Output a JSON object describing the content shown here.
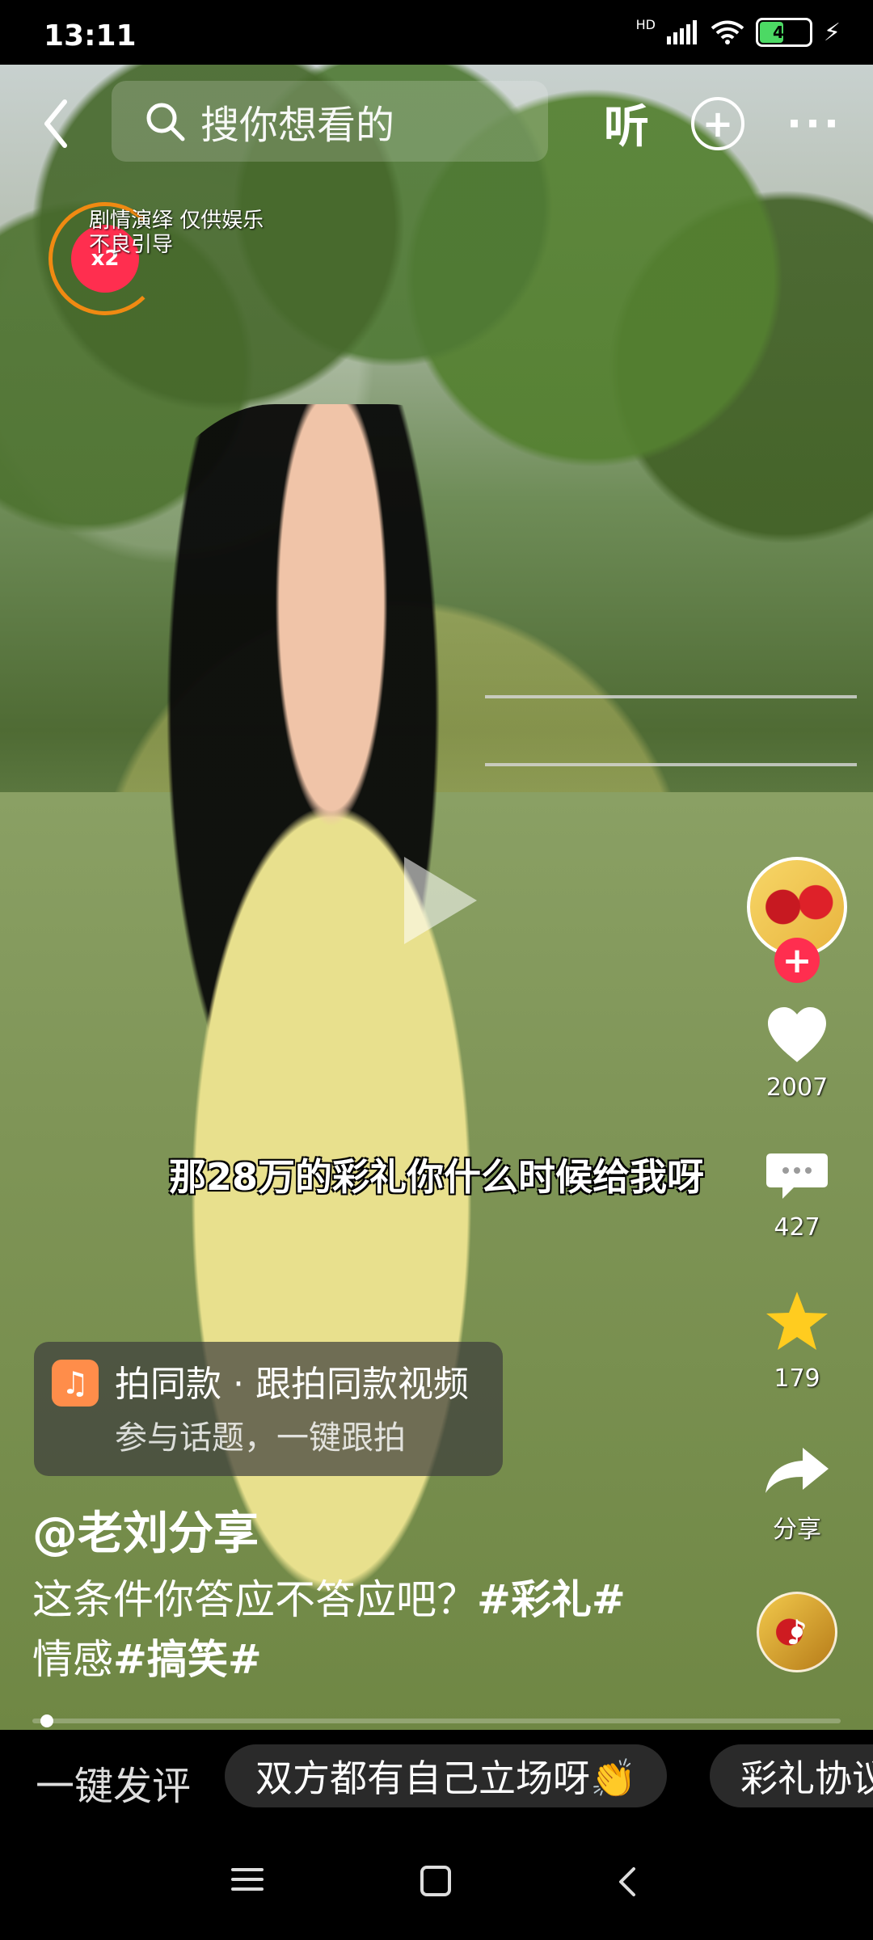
{
  "status": {
    "time": "13:11",
    "battery": "46",
    "network": "HD"
  },
  "top": {
    "search_placeholder": "搜你想看的",
    "listen": "听"
  },
  "notes": {
    "line1": "剧情演绎 仅供娱乐",
    "line2": "不良引导"
  },
  "badge": {
    "label": "x2"
  },
  "video": {
    "subtitle": "那28万的彩礼你什么时候给我呀"
  },
  "actions": {
    "likes": "2007",
    "comments": "427",
    "favorites": "179",
    "share": "分享"
  },
  "pai": {
    "title": "拍同款 · 跟拍同款视频",
    "subtitle": "参与话题，一键跟拍"
  },
  "post": {
    "author": "@老刘分享",
    "caption_prefix": "这条件你答应不答应吧？",
    "tag1": "#彩礼#",
    "caption_mid": "情感",
    "tag2": "#搞笑#"
  },
  "comment_bar": {
    "label": "一键发评",
    "chip1": "双方都有自己立场呀👏",
    "chip2": "彩礼协议"
  },
  "progress": {
    "value": 0.01
  }
}
